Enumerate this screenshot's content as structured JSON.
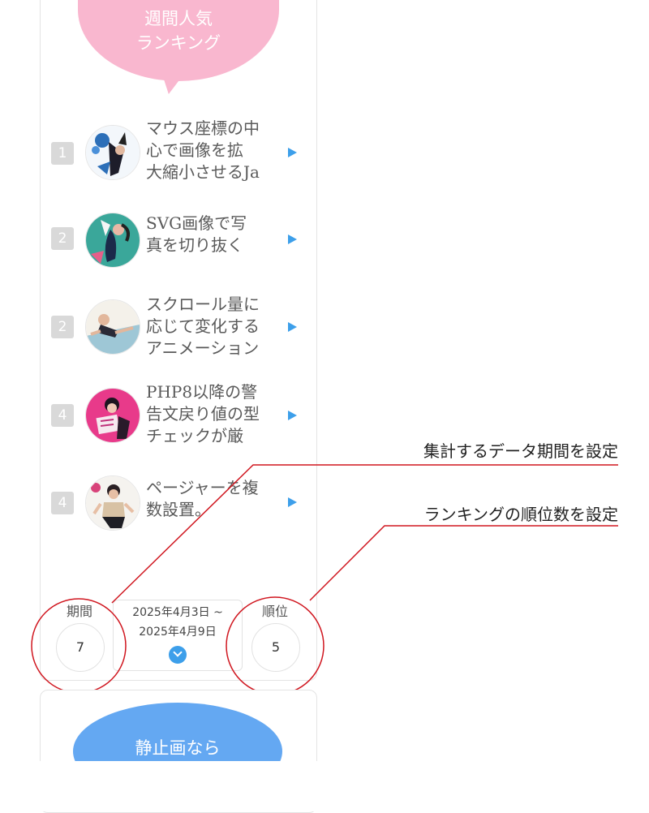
{
  "ranking": {
    "title_line1": "週間人気",
    "title_line2": "ランキング",
    "items": [
      {
        "rank": "1",
        "title": "マウス座標の中\n心で画像を拡\n大縮小させるJa"
      },
      {
        "rank": "2",
        "title": "SVG画像で写\n真を切り抜く"
      },
      {
        "rank": "2",
        "title": "スクロール量に\n応じて変化する\nアニメーション"
      },
      {
        "rank": "4",
        "title": "PHP8以降の警\n告文戻り値の型\nチェックが厳"
      },
      {
        "rank": "4",
        "title": "ページャーを複\n数設置。"
      }
    ]
  },
  "controls": {
    "period_label": "期間",
    "period_value": "7",
    "date_start": "2025年4月3日 ~",
    "date_end": "2025年4月9日",
    "rank_label": "順位",
    "rank_value": "5"
  },
  "annotations": {
    "period_note": "集計するデータ期間を設定",
    "rank_note": "ランキングの順位数を設定"
  },
  "next_widget": {
    "title": "静止画なら"
  },
  "colors": {
    "pink": "#f9b7cf",
    "blue": "#3d9fea",
    "annotation_red": "#d0161f"
  }
}
